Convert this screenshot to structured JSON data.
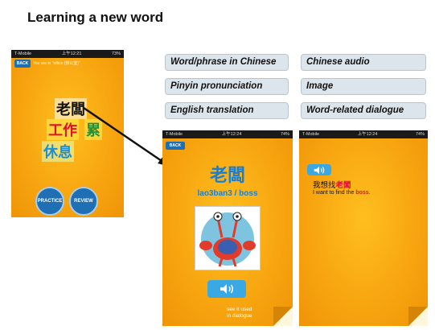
{
  "page_title": "Learning a new word",
  "phone1": {
    "carrier": "T-Mobile",
    "time": "上午12:21",
    "battery": "73%",
    "back_label": "BACK",
    "location_text": "You are in \"office (辦公室)\"",
    "words": [
      "老闆",
      "工作",
      "累",
      "休息"
    ],
    "practice_label": "PRACTICE",
    "review_label": "REVIEW"
  },
  "labels": [
    "Word/phrase in Chinese",
    "Chinese audio",
    "Pinyin pronunciation",
    "Image",
    "English translation",
    "Word-related dialogue"
  ],
  "phone2": {
    "carrier": "T-Mobile",
    "time": "上午12:24",
    "battery": "74%",
    "back_label": "BACK",
    "word": "老闆",
    "pinyin": "lao3ban3 / boss",
    "image_icon": "crab-character-image",
    "see_used": "see it used",
    "in_dialogue": "in dialogue"
  },
  "phone3": {
    "carrier": "T-Mobile",
    "time": "上午12:24",
    "battery": "74%",
    "dialogue_zh_prefix": "我想找",
    "dialogue_zh_word": "老闆",
    "dialogue_en_prefix": "I want to find the ",
    "dialogue_en_word": "boss",
    "dialogue_en_suffix": "."
  },
  "colors": {
    "phone_bg": "#f7a40f",
    "button_blue": "#1f6fb5",
    "pinyin_blue": "#1a7fd1",
    "highlight_red": "#e0102a"
  }
}
